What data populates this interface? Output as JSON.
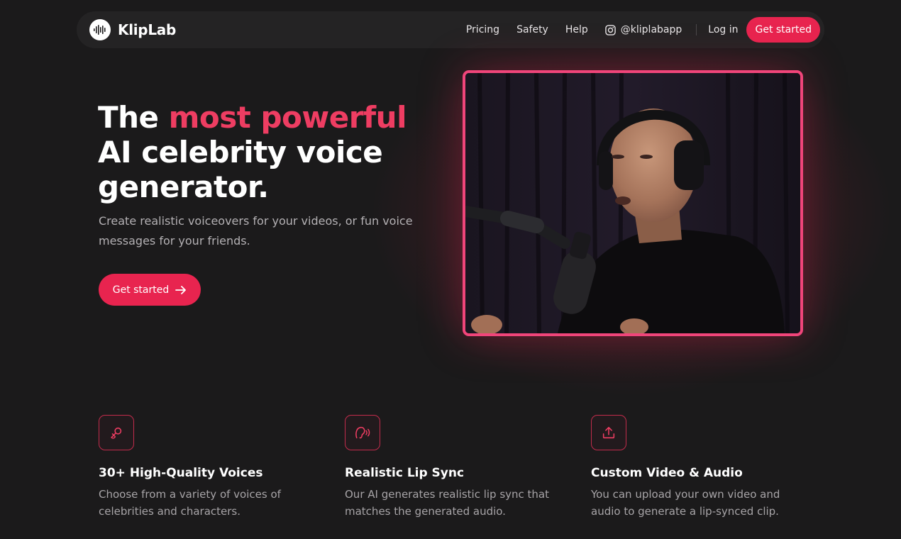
{
  "brand": {
    "name": "KlipLab"
  },
  "nav": {
    "links": [
      "Pricing",
      "Safety",
      "Help"
    ],
    "instagram": "@kliplabapp",
    "login": "Log in",
    "cta": "Get started"
  },
  "hero": {
    "title_pre": "The ",
    "title_accent": "most powerful",
    "title_post": "AI celebrity voice generator.",
    "subtitle": "Create realistic voiceovers for your videos, or fun voice messages for your friends.",
    "cta": "Get started"
  },
  "features": [
    {
      "icon": "microphone-icon",
      "title": "30+ High-Quality Voices",
      "desc": "Choose from a variety of voices of celebrities and characters."
    },
    {
      "icon": "lip-sync-icon",
      "title": "Realistic Lip Sync",
      "desc": "Our AI generates realistic lip sync that matches the generated audio."
    },
    {
      "icon": "upload-icon",
      "title": "Custom Video & Audio",
      "desc": "You can upload your own video and audio to generate a lip-synced clip."
    }
  ],
  "colors": {
    "accent": "#e8244f",
    "accent_text": "#ee3d62",
    "frame": "#f0457a",
    "background": "#1b1a1b"
  }
}
